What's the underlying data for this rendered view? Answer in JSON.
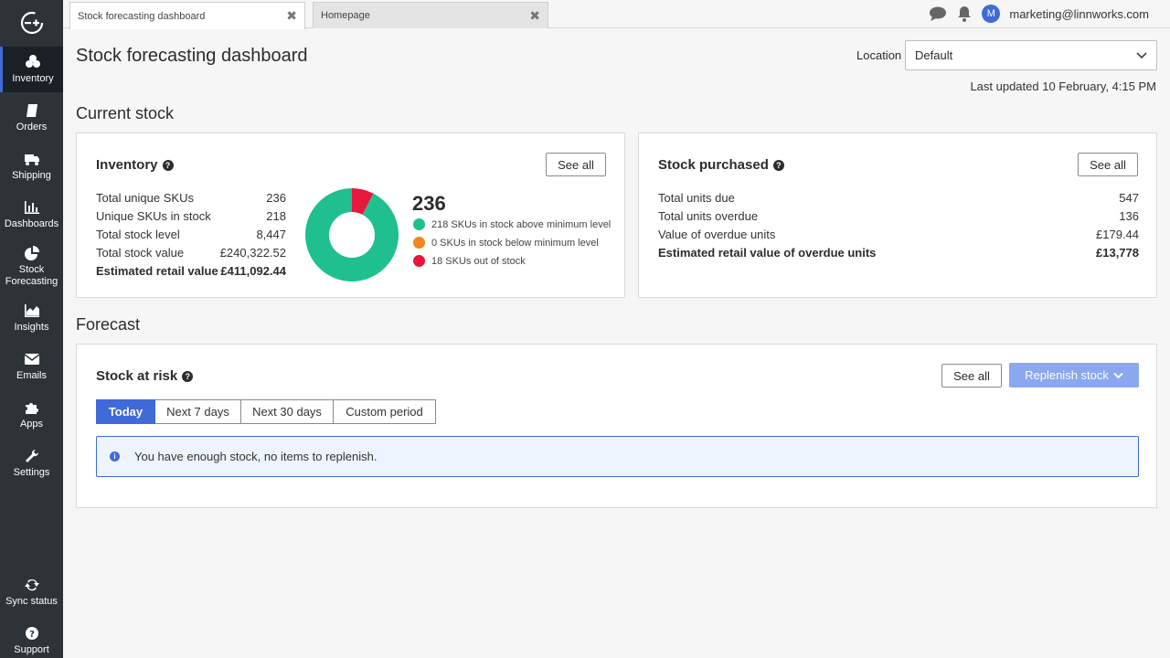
{
  "sidebar": {
    "items": [
      {
        "label": "Inventory",
        "icon": "inventory-icon",
        "active": true
      },
      {
        "label": "Orders",
        "icon": "orders-icon"
      },
      {
        "label": "Shipping",
        "icon": "truck-icon"
      },
      {
        "label": "Dashboards",
        "icon": "bar-chart-icon"
      },
      {
        "label": "Stock Forecasting",
        "icon": "pie-chart-icon"
      },
      {
        "label": "Insights",
        "icon": "area-chart-icon"
      },
      {
        "label": "Emails",
        "icon": "envelope-icon"
      },
      {
        "label": "Apps",
        "icon": "puzzle-icon"
      },
      {
        "label": "Settings",
        "icon": "wrench-icon"
      }
    ],
    "bottom": [
      {
        "label": "Sync status",
        "icon": "sync-icon"
      },
      {
        "label": "Support",
        "icon": "help-icon"
      }
    ]
  },
  "tabs": [
    {
      "label": "Stock forecasting dashboard",
      "active": true
    },
    {
      "label": "Homepage",
      "active": false
    }
  ],
  "user": {
    "initial": "M",
    "email": "marketing@linnworks.com"
  },
  "page": {
    "title": "Stock forecasting dashboard",
    "location_label": "Location",
    "location_value": "Default",
    "last_updated": "Last updated 10 February, 4:15 PM"
  },
  "current_stock": {
    "title": "Current stock",
    "inventory": {
      "title": "Inventory",
      "see_all": "See all",
      "rows": [
        {
          "label": "Total unique SKUs",
          "value": "236"
        },
        {
          "label": "Unique SKUs in stock",
          "value": "218"
        },
        {
          "label": "Total stock level",
          "value": "8,447"
        },
        {
          "label": "Total stock value",
          "value": "£240,322.52"
        },
        {
          "label": "Estimated retail value",
          "value": "£411,092.44",
          "bold": true
        }
      ],
      "total": "236",
      "legend": [
        {
          "label": "218 SKUs in stock above minimum level",
          "color": "#1fbf8f",
          "value": 218
        },
        {
          "label": "0 SKUs in stock below minimum level",
          "color": "#f0861c",
          "value": 0
        },
        {
          "label": "18 SKUs out of stock",
          "color": "#e8173c",
          "value": 18
        }
      ]
    },
    "purchased": {
      "title": "Stock purchased",
      "see_all": "See all",
      "rows": [
        {
          "label": "Total units due",
          "value": "547"
        },
        {
          "label": "Total units overdue",
          "value": "136"
        },
        {
          "label": "Value of overdue units",
          "value": "£179.44"
        },
        {
          "label": "Estimated retail value of overdue units",
          "value": "£13,778",
          "bold": true
        }
      ]
    }
  },
  "forecast": {
    "title": "Forecast",
    "risk": {
      "title": "Stock at risk",
      "see_all": "See all",
      "replenish": "Replenish stock",
      "periods": [
        "Today",
        "Next 7 days",
        "Next 30 days",
        "Custom period"
      ],
      "active_period": 0,
      "message": "You have enough stock, no items to replenish."
    }
  },
  "colors": {
    "accent": "#3f6ad8",
    "sidebar": "#2e3338",
    "primary_light": "#8aa7f0"
  }
}
